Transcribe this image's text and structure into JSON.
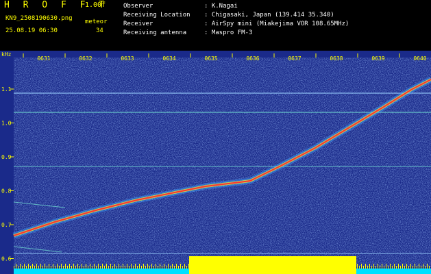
{
  "header": {
    "app_name": "H R O F F T",
    "version": "1.00f",
    "filename": "KN9_2508190630.png",
    "mode": "meteor",
    "datetime": "25.08.19 06:30",
    "count": "34"
  },
  "info": {
    "observer_label": "Observer",
    "observer_value": ": K.Nagai",
    "location_label": "Receiving Location",
    "location_value": ": Chigasaki, Japan (139.414 35.340)",
    "receiver_label": "Receiver",
    "receiver_value": ": AirSpy mini (Miakejima VOR 108.65MHz)",
    "antenna_label": "Receiving antenna",
    "antenna_value": ": Maspro FM-3"
  },
  "axis": {
    "y_unit": "kHz",
    "y_ticks": [
      "1.1",
      "1.0",
      "0.9",
      "0.8",
      "0.7",
      "0.6"
    ],
    "x_ticks": [
      "0631",
      "0632",
      "0633",
      "0634",
      "0635",
      "0636",
      "0637",
      "0638",
      "0639",
      "0640"
    ]
  },
  "colors": {
    "background": "#1a2a8a",
    "trace": "#ff3030",
    "label": "#ffff00",
    "line": "#9ad0ff"
  }
}
